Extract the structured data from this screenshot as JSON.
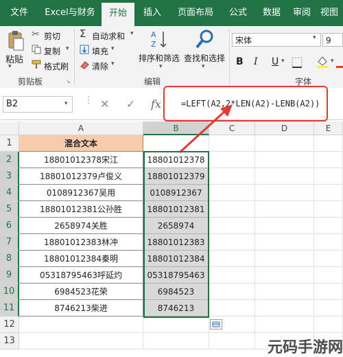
{
  "ribbon_tabs": [
    "文件",
    "Excel与财务",
    "开始",
    "插入",
    "页面布局",
    "公式",
    "数据",
    "审阅",
    "视图"
  ],
  "ribbon": {
    "paste": "粘贴",
    "cut": "剪切",
    "copy": "复制",
    "format_painter": "格式刷",
    "clipboard_group": "剪贴板",
    "autosum": "自动求和",
    "fill": "填充",
    "clear": "清除",
    "sort_filter": "排序和筛选",
    "find_select": "查找和选择",
    "editing_group": "编辑",
    "font_name": "宋体",
    "font_size": "9",
    "font_group": "字体",
    "bold": "B",
    "italic": "I",
    "underline": "U"
  },
  "formula_bar": {
    "name_box": "B2",
    "cancel": "✕",
    "enter": "✓",
    "fx": "fx",
    "formula": "=LEFT(A2,2*LEN(A2)-LENB(A2))"
  },
  "columns": [
    "A",
    "B",
    "C",
    "D",
    "E"
  ],
  "rows": [
    "1",
    "2",
    "3",
    "4",
    "5",
    "6",
    "7",
    "8",
    "9",
    "10",
    "11",
    "12",
    "13"
  ],
  "header_cell": "混合文本",
  "col_a": [
    "18801012378宋江",
    "18801012379卢俊义",
    "0108912367吴用",
    "18801012381公孙胜",
    "2658974关胜",
    "18801012383林冲",
    "18801012384秦明",
    "05318795463呼延灼",
    "6984523花荣",
    "8746213柴进"
  ],
  "col_b": [
    "18801012378",
    "18801012379",
    "0108912367",
    "18801012381",
    "2658974",
    "18801012383",
    "18801012384",
    "05318795463",
    "6984523",
    "8746213"
  ],
  "watermark": "元码手游网",
  "colors": {
    "ribbon_green": "#217346",
    "header_fill": "#f8cbad",
    "highlight_red": "#e53935",
    "selection_fill": "#d9d9d9"
  }
}
